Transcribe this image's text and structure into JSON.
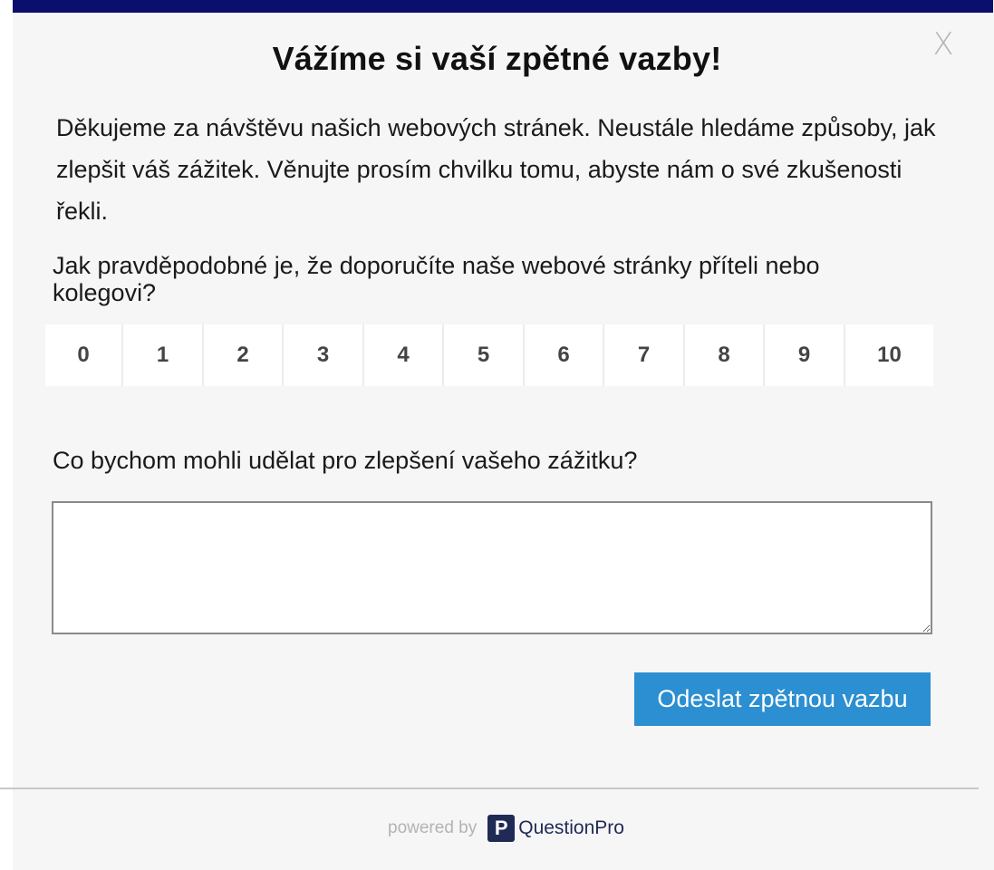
{
  "header": {
    "title": "Vážíme si vaší zpětné vazby!",
    "close_label": "X"
  },
  "intro_text": "Děkujeme za návštěvu našich webových stránek. Neustále hledáme způsoby, jak zlepšit váš zážitek. Věnujte prosím chvilku tomu, abyste nám o své zkušenosti řekli.",
  "nps": {
    "question": "Jak pravděpodobné je, že doporučíte naše webové stránky příteli nebo kolegovi?",
    "options": [
      "0",
      "1",
      "2",
      "3",
      "4",
      "5",
      "6",
      "7",
      "8",
      "9",
      "10"
    ]
  },
  "improvement": {
    "question": "Co bychom mohli udělat pro zlepšení vašeho zážitku?",
    "value": "",
    "placeholder": ""
  },
  "submit_label": "Odeslat zpětnou vazbu",
  "footer": {
    "powered_by": "powered by",
    "logo_letter": "P",
    "brand": "QuestionPro"
  },
  "colors": {
    "top_bar": "#0a0f6e",
    "submit_bg": "#2b8fd1",
    "brand": "#1f2a55"
  }
}
